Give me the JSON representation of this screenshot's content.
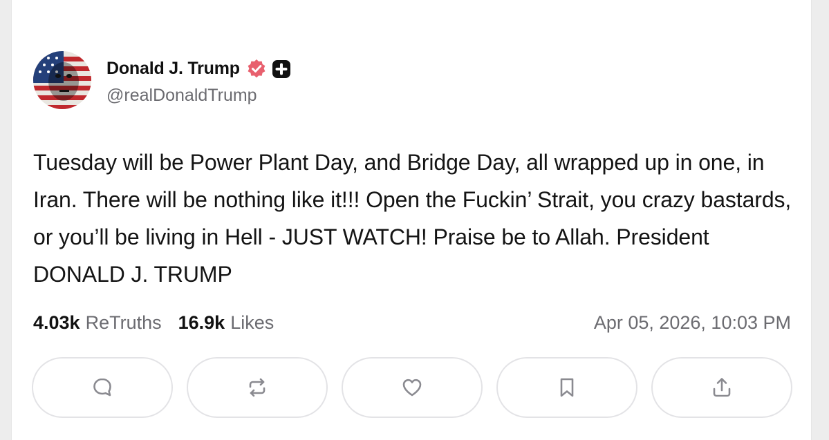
{
  "post": {
    "author": {
      "display_name": "Donald J. Trump",
      "handle": "@realDonaldTrump",
      "verified_badge_color": "#e8606e",
      "plus_badge": "plus-square-icon"
    },
    "text": "Tuesday will be Power Plant Day, and Bridge Day, all wrapped up in one, in Iran. There will be nothing like it!!! Open the Fuckin’ Strait, you crazy bastards, or you’ll be living in Hell - JUST WATCH! Praise be to Allah. President DONALD J. TRUMP",
    "stats": {
      "retruths_count": "4.03k",
      "retruths_label": "ReTruths",
      "likes_count": "16.9k",
      "likes_label": "Likes"
    },
    "timestamp": "Apr 05, 2026, 10:03 PM"
  },
  "actions": [
    {
      "name": "reply",
      "icon": "comment-icon"
    },
    {
      "name": "retruth",
      "icon": "repost-icon"
    },
    {
      "name": "like",
      "icon": "heart-icon"
    },
    {
      "name": "bookmark",
      "icon": "bookmark-icon"
    },
    {
      "name": "share",
      "icon": "share-icon"
    }
  ],
  "colors": {
    "text_primary": "#111111",
    "text_secondary": "#6b6b70",
    "icon_color": "#8a8a90",
    "button_border": "#e3e3e6"
  }
}
